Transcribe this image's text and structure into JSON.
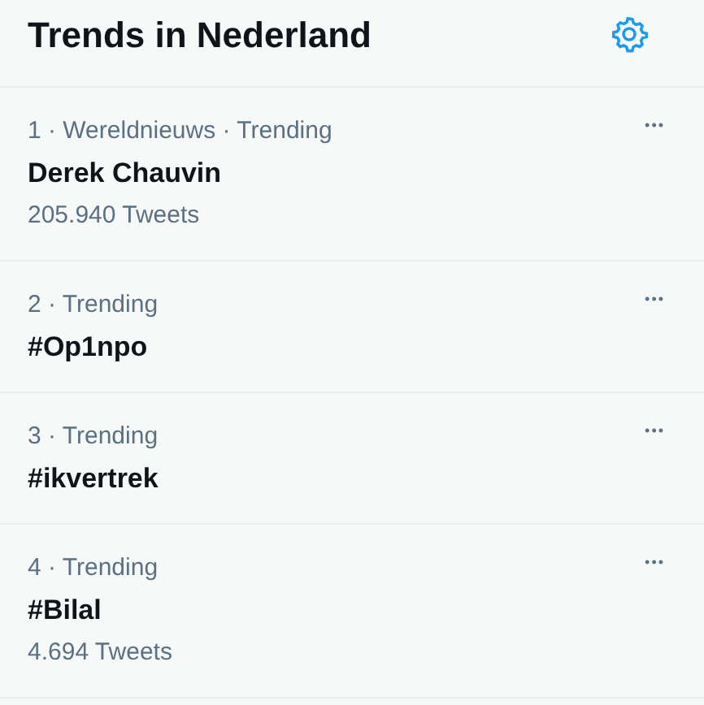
{
  "header": {
    "title": "Trends in Nederland"
  },
  "trends": [
    {
      "meta": "1 · Wereldnieuws · Trending",
      "topic": "Derek Chauvin",
      "count": "205.940 Tweets",
      "more": "•••"
    },
    {
      "meta": "2 · Trending",
      "topic": "#Op1npo",
      "more": "•••"
    },
    {
      "meta": "3 · Trending",
      "topic": "#ikvertrek",
      "more": "•••"
    },
    {
      "meta": "4 · Trending",
      "topic": "#Bilal",
      "count": "4.694 Tweets",
      "more": "•••"
    }
  ]
}
